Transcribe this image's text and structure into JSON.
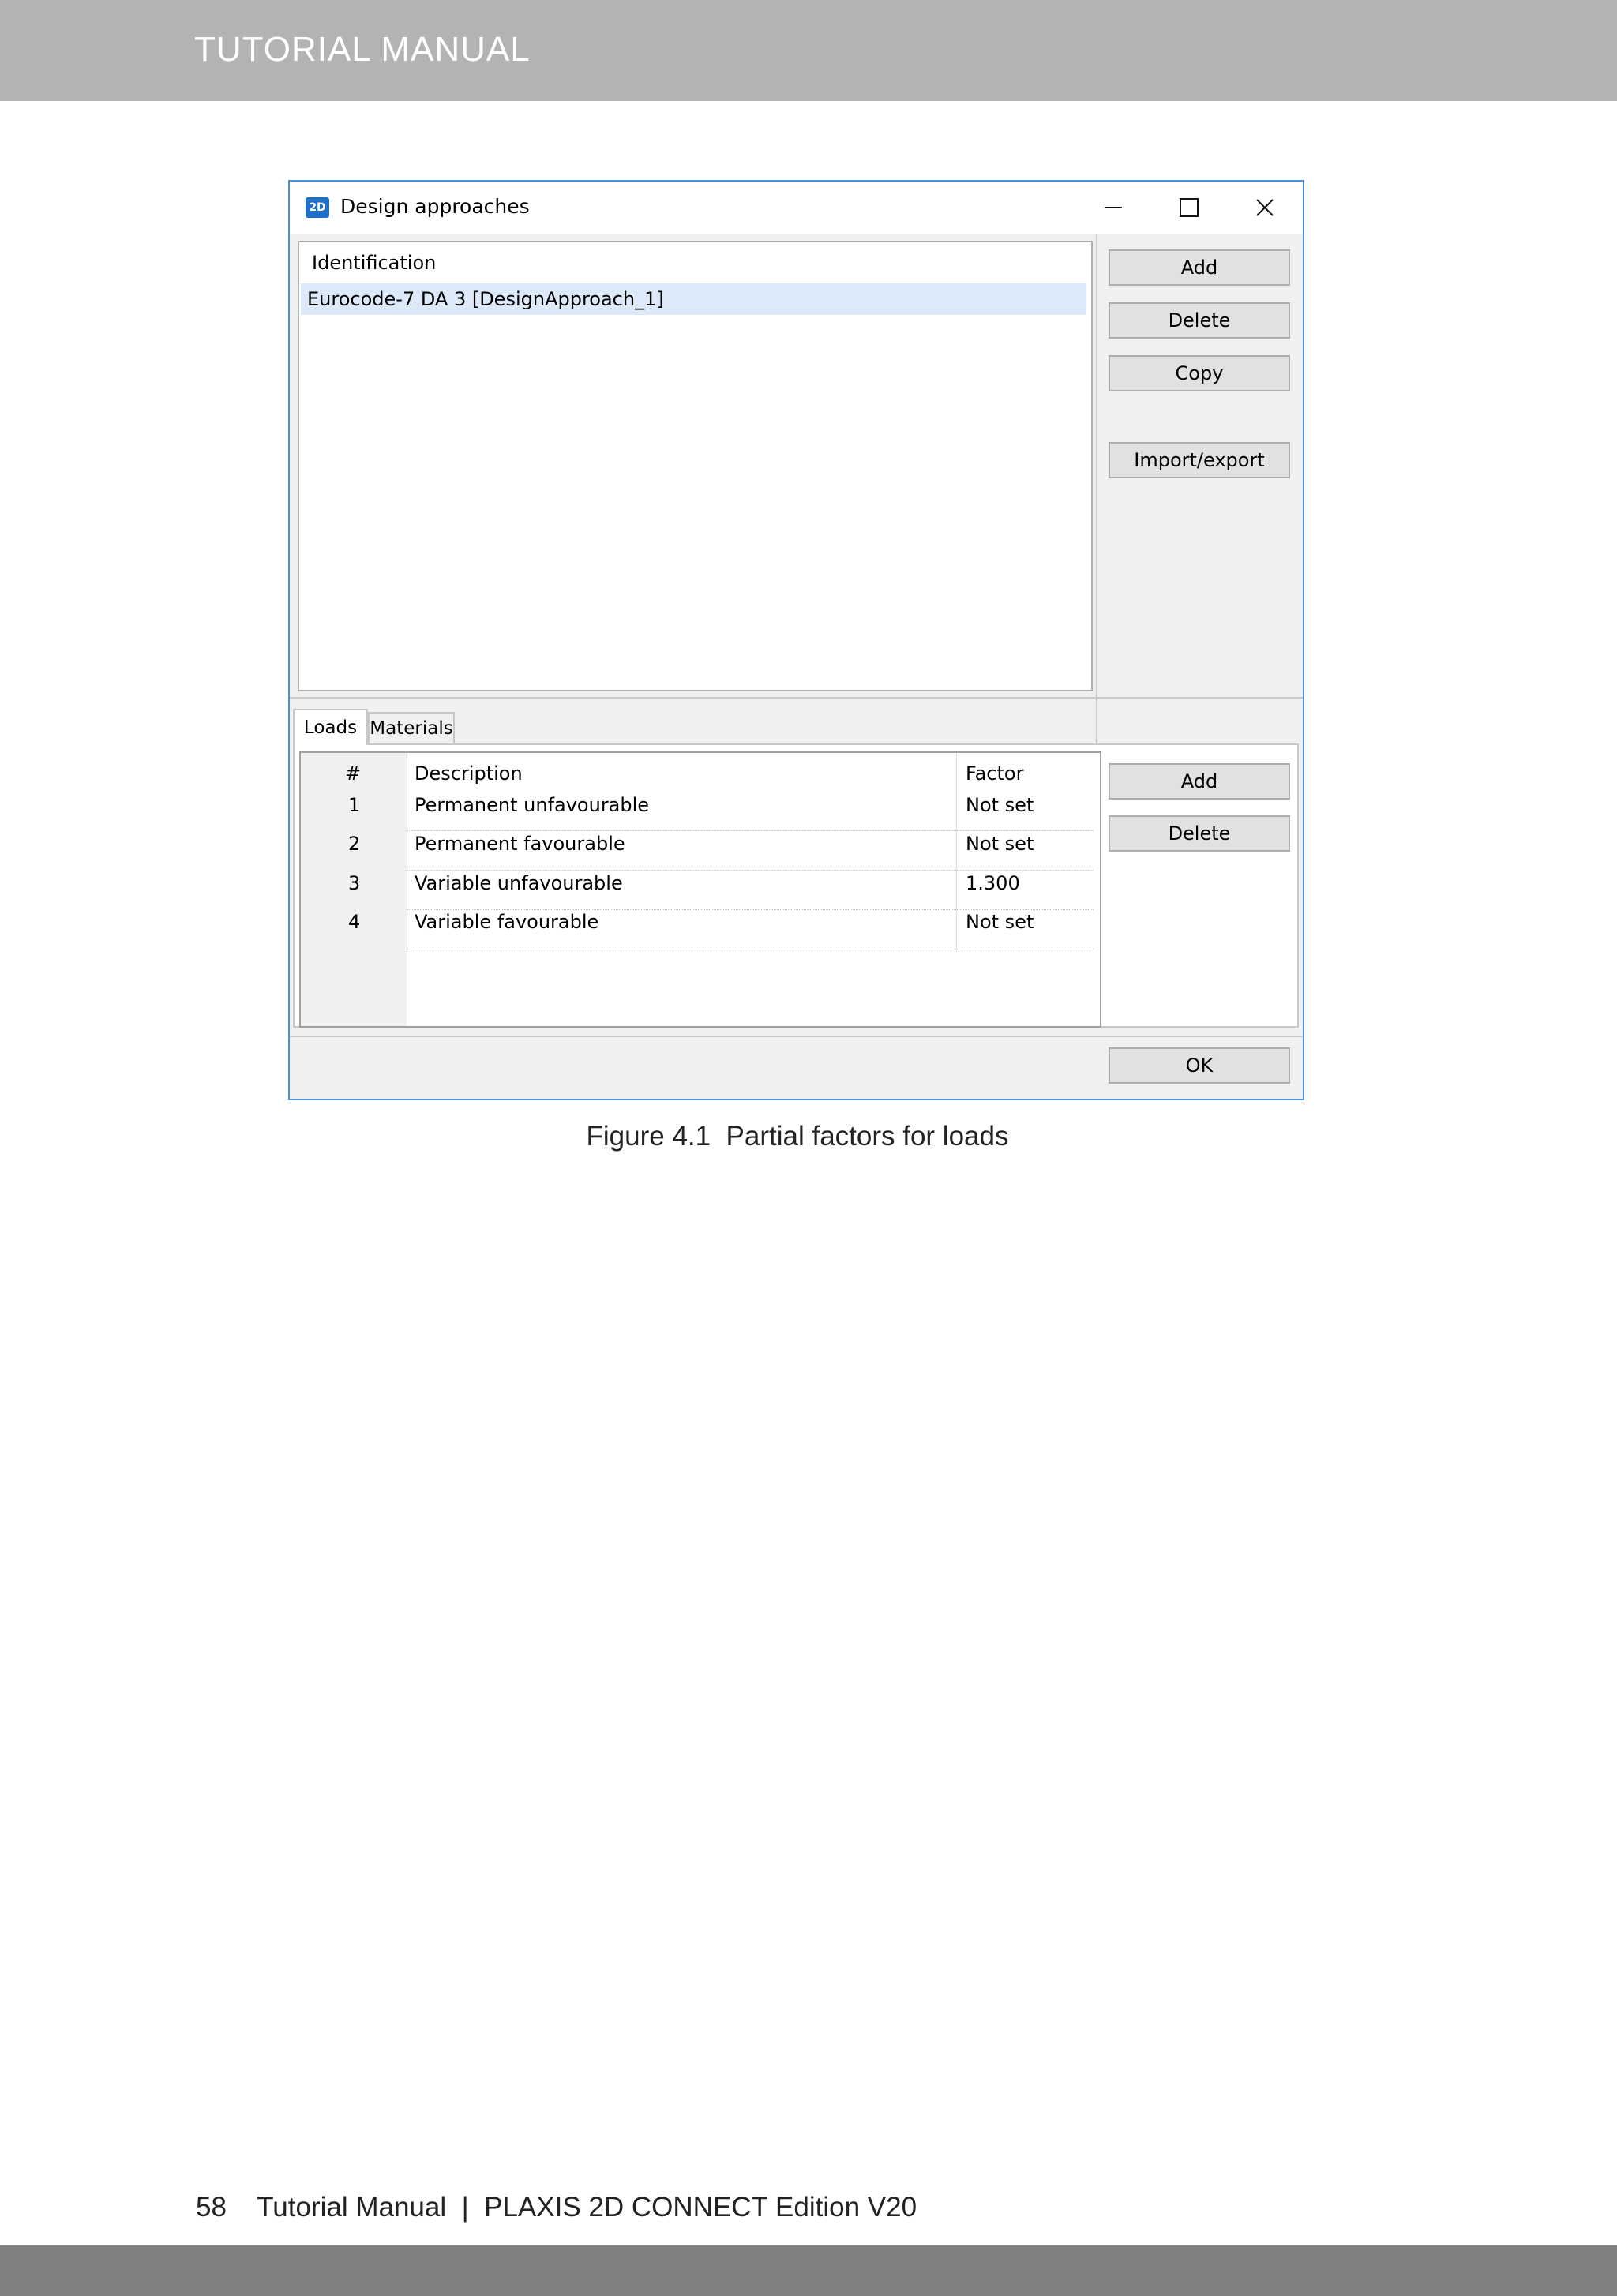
{
  "header": {
    "title": "TUTORIAL MANUAL"
  },
  "dialog": {
    "title": "Design approaches",
    "app_icon": "2D",
    "window_controls": {
      "minimize": "minimize-icon",
      "maximize": "maximize-icon",
      "close": "close-icon"
    },
    "identification": {
      "header": "Identification",
      "items": [
        "Eurocode-7 DA 3 [DesignApproach_1]"
      ],
      "selected_index": 0
    },
    "top_buttons": {
      "add": "Add",
      "delete": "Delete",
      "copy": "Copy",
      "import_export": "Import/export"
    },
    "tabs": [
      {
        "label": "Loads",
        "active": true
      },
      {
        "label": "Materials",
        "active": false
      }
    ],
    "loads_table": {
      "columns": [
        "#",
        "Description",
        "Factor"
      ],
      "rows": [
        {
          "num": "1",
          "description": "Permanent unfavourable",
          "factor": "Not set"
        },
        {
          "num": "2",
          "description": "Permanent favourable",
          "factor": "Not set"
        },
        {
          "num": "3",
          "description": "Variable unfavourable",
          "factor": "1.300"
        },
        {
          "num": "4",
          "description": "Variable favourable",
          "factor": "Not set"
        }
      ]
    },
    "bottom_buttons": {
      "add": "Add",
      "delete": "Delete"
    },
    "ok_label": "OK"
  },
  "caption": "Figure 4.1  Partial factors for loads",
  "footer": {
    "page_number": "58",
    "text": "Tutorial Manual  |  PLAXIS 2D CONNECT Edition V20"
  }
}
